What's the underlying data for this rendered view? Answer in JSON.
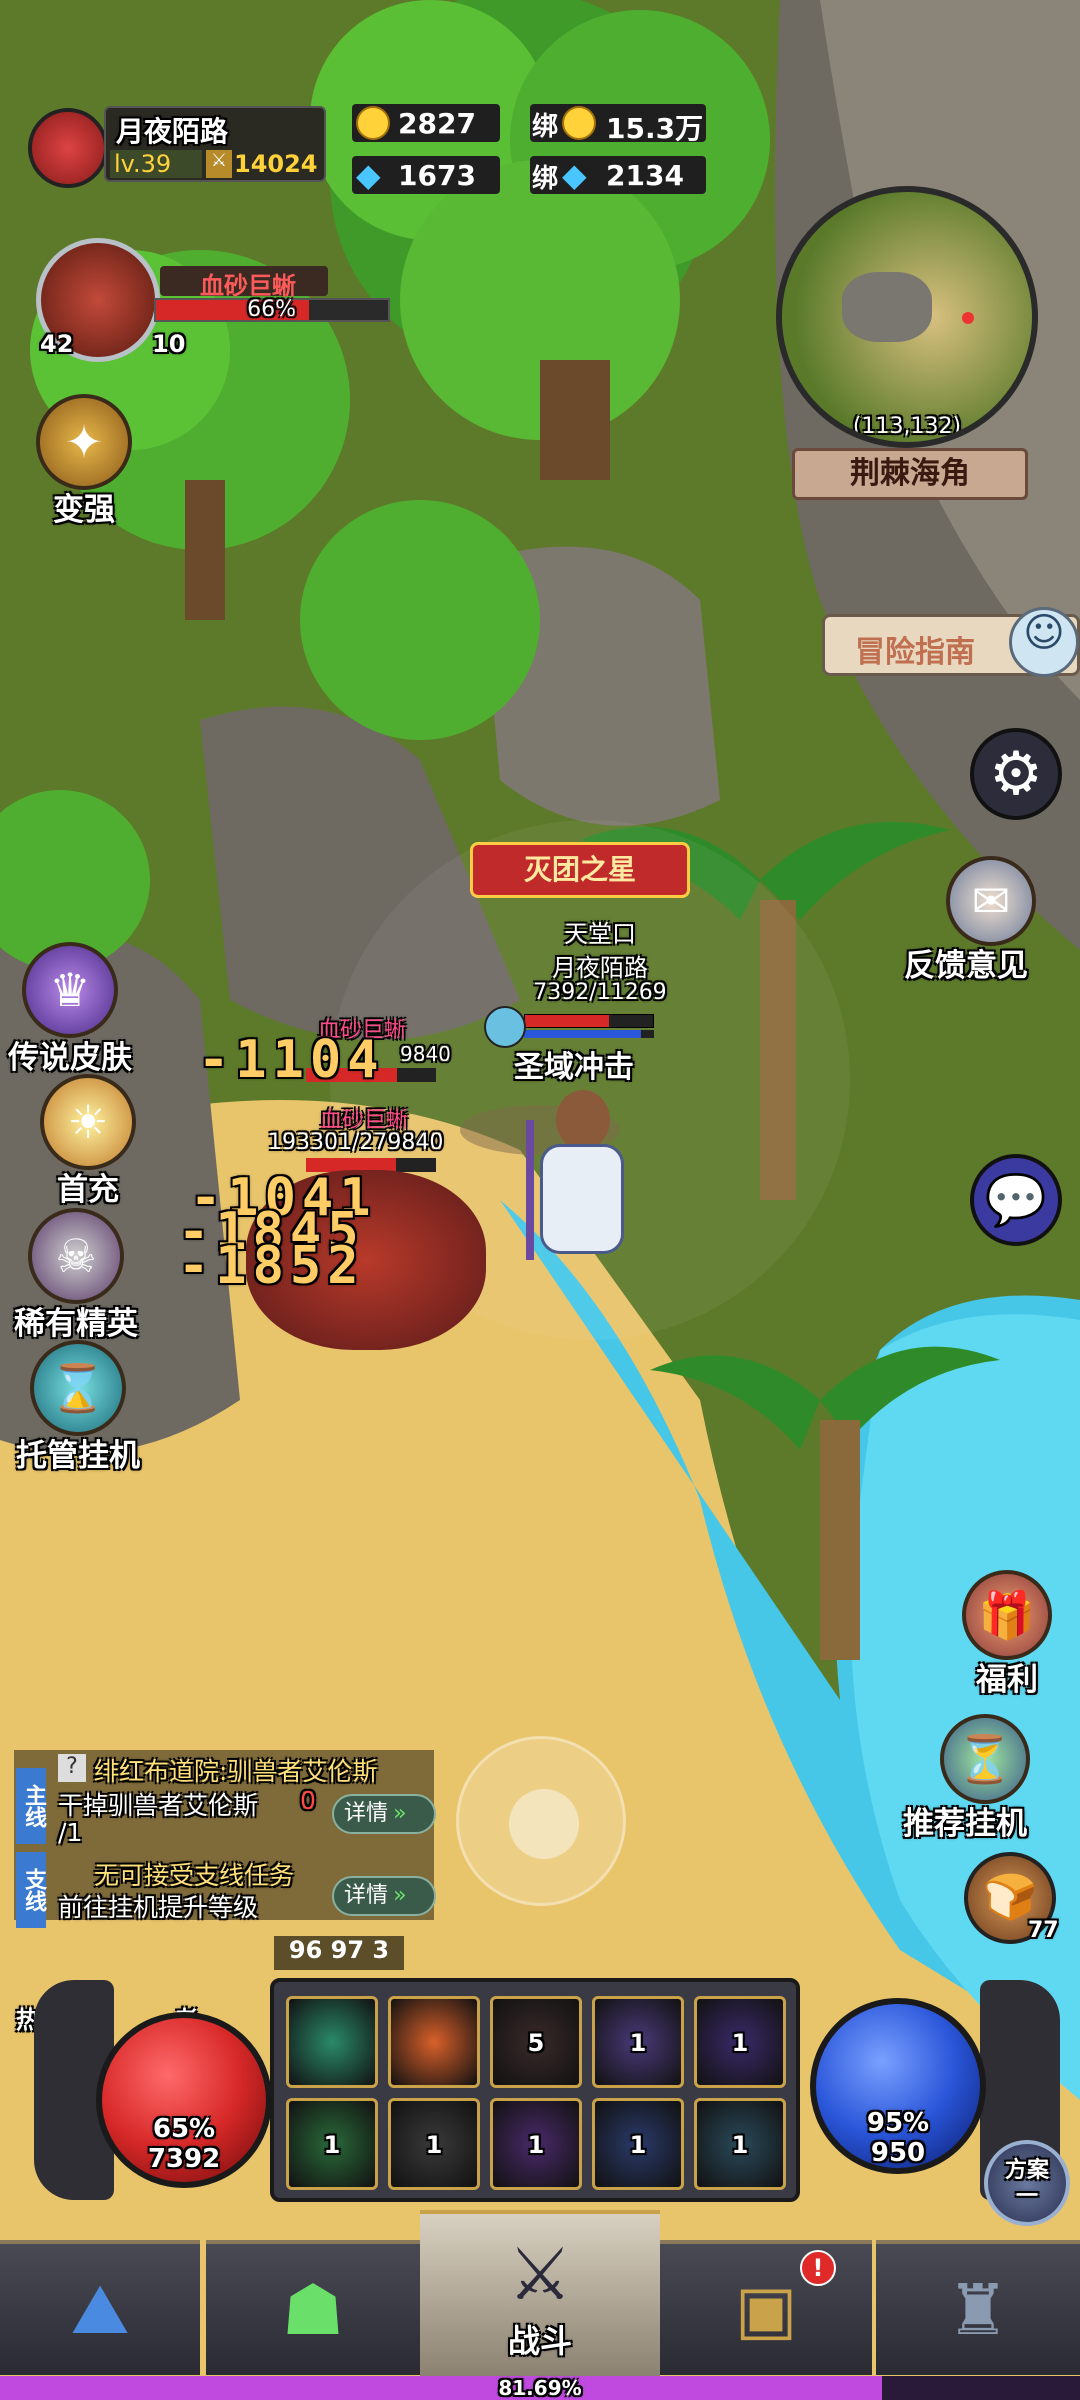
{
  "colors": {
    "hp": "#d72828",
    "mp": "#2a56d9",
    "xp": "#c04ae0",
    "gold": "#ffd23a",
    "gem": "#49c6ff"
  },
  "player": {
    "name": "月夜陌路",
    "level": "lv.39",
    "power": "14024"
  },
  "currency": {
    "gold": "2827",
    "bound_gold_label": "绑",
    "bound_gold": "15.3万",
    "gems": "1673",
    "bound_gem_label": "绑",
    "bound_gems": "2134"
  },
  "target": {
    "name": "血砂巨蜥",
    "hp_percent": "66%",
    "hp_fraction": 0.66,
    "level": "42",
    "count": "10"
  },
  "minimap": {
    "coords": "(113,132)",
    "area": "荆棘海角"
  },
  "left_menu": {
    "strengthen": "变强",
    "legend_skin": "传说皮肤",
    "first_recharge": "首充",
    "rare_elite": "稀有精英",
    "auto_hang": "托管挂机"
  },
  "right_menu": {
    "guide": "冒险指南",
    "settings_icon": "gear-icon",
    "feedback": "反馈意见",
    "chat_icon": "chat-icon",
    "welfare": "福利",
    "recommend_hang": "推荐挂机",
    "bread_count": "77"
  },
  "battle": {
    "title_badge": "灭团之星",
    "guild": "天堂口",
    "hero_name": "月夜陌路",
    "hero_hp": "7392/11269",
    "skill_cast": "圣域冲击",
    "enemy1_name": "血砂巨蜥",
    "enemy1_hp": "9840",
    "enemy2_name": "血砂巨蜥",
    "enemy2_hp": "193301/279840",
    "damage1": "-1104",
    "damage2": "-1041",
    "damage3": "-1845",
    "damage4": "-1852"
  },
  "quests": {
    "main_tag": "主线",
    "main_title": "绯红布道院:驯兽者艾伦斯",
    "main_desc": "干掉驯兽者艾伦斯",
    "main_progress_a": "0",
    "main_progress_b": "/1",
    "side_tag": "支线",
    "side_title": "无可接受支线任务",
    "side_desc": "前往挂机提升等级",
    "detail_btn": "详情"
  },
  "skillbar": {
    "counters": "96 97 3",
    "slots_top": [
      "",
      "",
      "5",
      "1",
      "1"
    ],
    "slots_bottom": [
      "1",
      "1",
      "1",
      "1",
      "1"
    ]
  },
  "orbs": {
    "hp_percent": "65%",
    "hp_value": "7392",
    "mp_percent": "95%",
    "mp_value": "950",
    "plan": "方案一"
  },
  "nav": {
    "battle": "战斗",
    "xp_percent": "81.69%",
    "xp_fraction": 0.8169
  },
  "misc": {
    "hot_label": "热",
    "partial_label": "者"
  }
}
